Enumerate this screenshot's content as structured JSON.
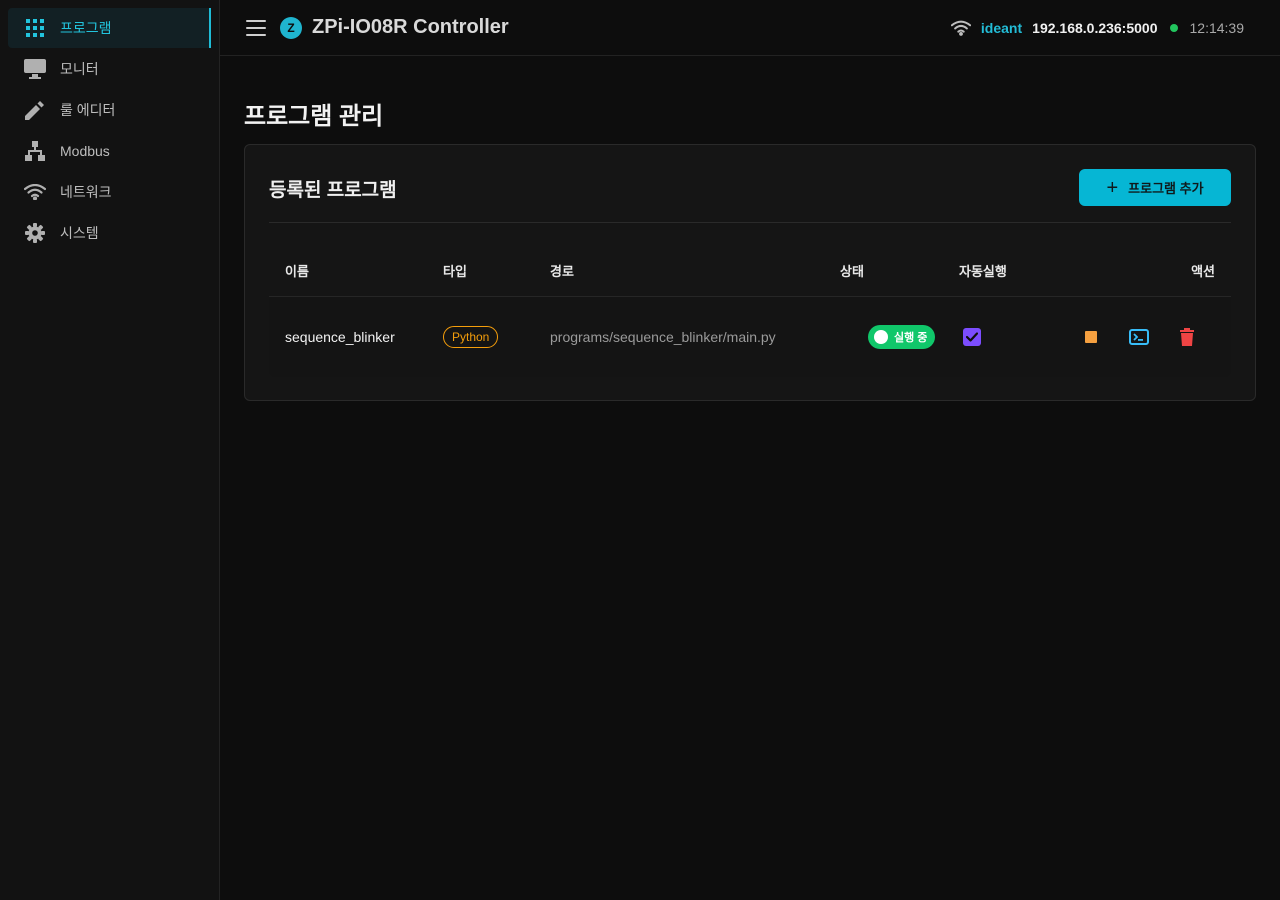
{
  "sidebar": {
    "items": [
      {
        "label": "프로그램",
        "icon": "grid-icon",
        "active": true
      },
      {
        "label": "모니터",
        "icon": "monitor-icon"
      },
      {
        "label": "룰 에디터",
        "icon": "pencil-icon"
      },
      {
        "label": "Modbus",
        "icon": "network-tree-icon"
      },
      {
        "label": "네트워크",
        "icon": "wifi-icon"
      },
      {
        "label": "시스템",
        "icon": "gear-icon"
      }
    ]
  },
  "header": {
    "logo_letter": "Z",
    "title": "ZPi-IO08R Controller",
    "host": "ideant",
    "address": "192.168.0.236:5000",
    "time": "12:14:39",
    "accent_color": "#06b6d4",
    "online_color": "#22c55e"
  },
  "main": {
    "page_title": "프로그램 관리",
    "card_title": "등록된 프로그램",
    "add_button_icon": "+",
    "add_button_label": "프로그램 추가",
    "columns": [
      "이름",
      "타입",
      "경로",
      "상태",
      "자동실행",
      "액션"
    ],
    "rows": [
      {
        "name": "sequence_blinker",
        "type": "Python",
        "path": "programs/sequence_blinker/main.py",
        "status": "실행 중",
        "autorun": true,
        "actions": [
          "stop-icon",
          "terminal-icon",
          "trash-icon"
        ]
      }
    ]
  }
}
